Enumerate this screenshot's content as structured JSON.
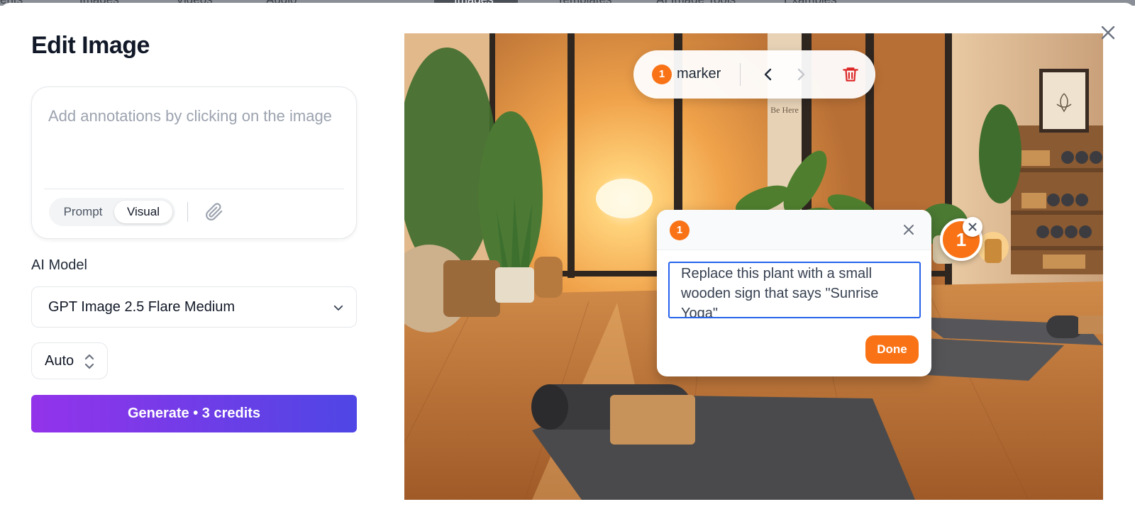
{
  "background_nav": {
    "items": [
      "ents",
      "Images",
      "Videos",
      "Audio",
      "Images",
      "Templates",
      "AI Image Tools",
      "Examples"
    ]
  },
  "modal": {
    "title": "Edit Image",
    "prompt": {
      "placeholder": "Add annotations by clicking on the image",
      "modes": [
        "Prompt",
        "Visual"
      ],
      "active_mode": "Visual"
    },
    "ai_model": {
      "label": "AI Model",
      "selected": "GPT Image 2.5 Flare Medium"
    },
    "size_select": {
      "selected": "Auto"
    },
    "generate_button": "Generate • 3 credits"
  },
  "marker_toolbar": {
    "index": "1",
    "label": "marker"
  },
  "annotation": {
    "index": "1",
    "text": "Replace this plant with a small wooden sign that says \"Sunrise Yoga\"",
    "done_label": "Done",
    "pin_label": "1"
  },
  "image": {
    "wall_sign": [
      "Be Here"
    ]
  },
  "colors": {
    "accent_orange": "#f97316",
    "gradient_start": "#9333ea",
    "gradient_end": "#4f46e5",
    "focus_blue": "#2563eb",
    "danger_red": "#dc2626"
  }
}
